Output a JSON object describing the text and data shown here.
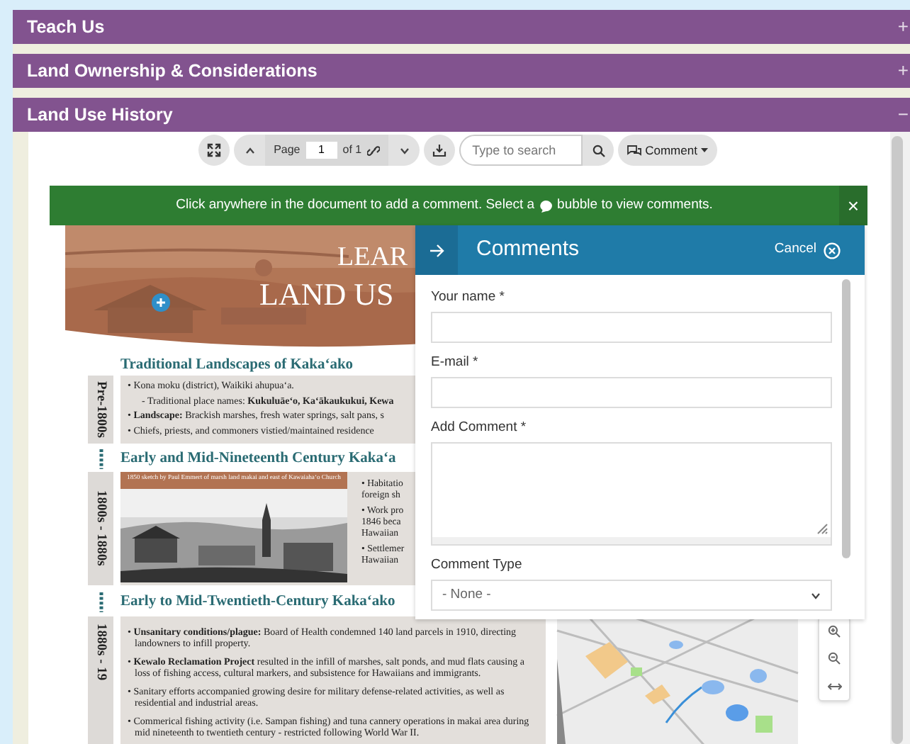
{
  "accordion": [
    {
      "title": "Teach Us",
      "toggle": "+",
      "expanded": false
    },
    {
      "title": "Land Ownership & Considerations",
      "toggle": "+",
      "expanded": false
    },
    {
      "title": "Land Use History",
      "toggle": "−",
      "expanded": true
    }
  ],
  "viewer": {
    "toolbar": {
      "page_label": "Page",
      "page": "1",
      "page_count": "of 1",
      "search_placeholder": "Type to search",
      "comment_button": "Comment"
    },
    "banner": {
      "text_before": "Click anywhere in the document to add a comment. Select a",
      "text_after": "bubble to view comments.",
      "close": "×"
    },
    "document": {
      "title_lines": [
        "LEAR",
        "LAND US"
      ],
      "sections": [
        {
          "kind": "bullets",
          "heading": "Traditional Landscapes of Kaka‘ako",
          "period": "Pre-1800s",
          "items": [
            {
              "text": "• Kona moku (district), Waikiki ahupua‘a.",
              "children": [
                {
                  "text": "- Traditional place names: **Kukuluāe‘o, Ka‘ākaukukui, Kewa**"
                }
              ]
            },
            {
              "text": "• **Landscape:** Brackish marshes, fresh water springs, salt pans, s"
            },
            {
              "text": "• Chiefs, priests, and commoners vistied/maintained residence"
            }
          ]
        },
        {
          "kind": "figure",
          "heading": "Early and Mid-Nineteenth Century Kaka‘a",
          "period": "1800s - 1880s",
          "caption": "1850 sketch by Paul Emmert of marsh land makai and east of Kawaiaha‘o Church",
          "items": [
            {
              "lines": [
                "• Habitatio",
                "foreign sh"
              ]
            },
            {
              "lines": [
                "• Work pro",
                "1846 beca",
                "Hawaiian"
              ]
            },
            {
              "lines": [
                "• Settlemer",
                "Hawaiian"
              ]
            }
          ]
        },
        {
          "kind": "map",
          "heading": "Early to Mid-Twentieth-Century Kaka‘ako",
          "period": "1880s - 19",
          "items": [
            {
              "text": "• **Unsanitary conditions/plague:** Board of Health condemned 140 land parcels in 1910, directing landowners to infill property."
            },
            {
              "text": "• **Kewalo Reclamation Project** resulted in the infill of marshes, salt ponds, and mud flats causing a loss of fishing access, cultural markers, and subsistence for Hawaiians and immigrants."
            },
            {
              "text": "• Sanitary efforts accompanied growing desire for military defense-related activities, as well as residential and industrial areas."
            },
            {
              "text": "• Commerical fishing activity (i.e. Sampan fishing) and tuna cannery operations in makai area during mid nineteenth to twentieth century - restricted following World War II."
            }
          ]
        }
      ]
    },
    "comments": {
      "title": "Comments",
      "cancel": "Cancel",
      "fields": [
        {
          "kind": "input",
          "label": "Your name *"
        },
        {
          "kind": "input",
          "label": "E-mail *"
        },
        {
          "kind": "textarea",
          "label": "Add Comment *"
        },
        {
          "kind": "select",
          "label": "Comment Type",
          "value": "- None -"
        }
      ]
    }
  }
}
